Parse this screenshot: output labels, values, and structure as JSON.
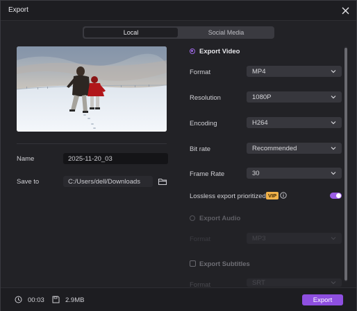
{
  "window": {
    "title": "Export"
  },
  "tabs": [
    {
      "label": "Local"
    },
    {
      "label": "Social Media"
    }
  ],
  "left": {
    "name_label": "Name",
    "name_value": "2025-11-20_03",
    "save_label": "Save to",
    "save_value": "C:/Users/dell/Downloads"
  },
  "export_video": {
    "label": "Export Video",
    "rows": [
      {
        "label": "Format",
        "value": "MP4"
      },
      {
        "label": "Resolution",
        "value": "1080P"
      },
      {
        "label": "Encoding",
        "value": "H264"
      },
      {
        "label": "Bit rate",
        "value": "Recommended"
      },
      {
        "label": "Frame Rate",
        "value": "30"
      }
    ],
    "lossless_label": "Lossless export prioritized",
    "vip_badge": "VIP"
  },
  "export_audio": {
    "label": "Export Audio",
    "row": {
      "label": "Format",
      "value": "MP3"
    }
  },
  "export_subtitles": {
    "label": "Export Subtitles",
    "row": {
      "label": "Format",
      "value": "SRT"
    }
  },
  "footer": {
    "duration": "00:03",
    "size": "2.9MB",
    "export_label": "Export"
  },
  "colors": {
    "accent": "#8e4fe0",
    "vip": "#f1b24a"
  }
}
